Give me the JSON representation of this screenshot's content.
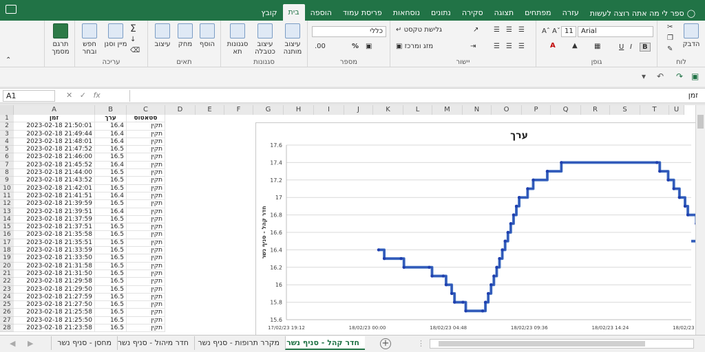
{
  "tabs": [
    "קובץ",
    "בית",
    "הוספה",
    "פריסת עמוד",
    "נוסחאות",
    "נתונים",
    "סקירה",
    "תצוגה",
    "מפתחים",
    "עזרה"
  ],
  "active_tab": "בית",
  "tell_me": "ספר לי מה אתה רוצה לעשות",
  "ribbon": {
    "groups": {
      "clipboard": "לוח",
      "font": "גופן",
      "alignment": "יישור",
      "number": "מספר",
      "styles": "סגנונות",
      "cells": "תאים",
      "editing": "עריכה"
    },
    "paste": "הדבק",
    "font_name": "Arial",
    "font_size": "11",
    "bold": "B",
    "italic": "I",
    "underline": "U",
    "wrap_text": "גלישת טקסט",
    "merge_center": "מזג ומרכז",
    "number_format": "כללי",
    "percent": "%",
    "conditional_format": "עיצוב מותנה",
    "format_as_table": "עיצוב כטבלה",
    "cell_styles": "סגנונות תא",
    "insert": "הוסף",
    "delete": "מחק",
    "format": "עיצוב",
    "sort_filter": "מיין וסנן",
    "find_select": "חפש ובחר",
    "translate": "תרגם מסמך"
  },
  "namebox": "A1",
  "formula": "זמן",
  "columns": [
    "A",
    "B",
    "C",
    "D",
    "E",
    "F",
    "G",
    "H",
    "I",
    "J",
    "K",
    "L",
    "M",
    "N",
    "O",
    "P",
    "Q",
    "R",
    "S",
    "T",
    "U"
  ],
  "headers": {
    "time": "זמן",
    "value": "ערך",
    "status": "סטאטוס"
  },
  "rows": [
    [
      "2023-02-18 21:50:01",
      "16.4",
      "תקין"
    ],
    [
      "2023-02-18 21:49:44",
      "16.4",
      "תקין"
    ],
    [
      "2023-02-18 21:48:01",
      "16.4",
      "תקין"
    ],
    [
      "2023-02-18 21:47:52",
      "16.5",
      "תקין"
    ],
    [
      "2023-02-18 21:46:00",
      "16.5",
      "תקין"
    ],
    [
      "2023-02-18 21:45:52",
      "16.4",
      "תקין"
    ],
    [
      "2023-02-18 21:44:00",
      "16.5",
      "תקין"
    ],
    [
      "2023-02-18 21:43:52",
      "16.5",
      "תקין"
    ],
    [
      "2023-02-18 21:42:01",
      "16.5",
      "תקין"
    ],
    [
      "2023-02-18 21:41:51",
      "16.4",
      "תקין"
    ],
    [
      "2023-02-18 21:39:59",
      "16.5",
      "תקין"
    ],
    [
      "2023-02-18 21:39:51",
      "16.4",
      "תקין"
    ],
    [
      "2023-02-18 21:37:59",
      "16.5",
      "תקין"
    ],
    [
      "2023-02-18 21:37:51",
      "16.5",
      "תקין"
    ],
    [
      "2023-02-18 21:35:58",
      "16.5",
      "תקין"
    ],
    [
      "2023-02-18 21:35:51",
      "16.5",
      "תקין"
    ],
    [
      "2023-02-18 21:33:59",
      "16.5",
      "תקין"
    ],
    [
      "2023-02-18 21:33:50",
      "16.5",
      "תקין"
    ],
    [
      "2023-02-18 21:31:58",
      "16.5",
      "תקין"
    ],
    [
      "2023-02-18 21:31:50",
      "16.5",
      "תקין"
    ],
    [
      "2023-02-18 21:29:58",
      "16.5",
      "תקין"
    ],
    [
      "2023-02-18 21:29:50",
      "16.5",
      "תקין"
    ],
    [
      "2023-02-18 21:27:59",
      "16.5",
      "תקין"
    ],
    [
      "2023-02-18 21:27:50",
      "16.5",
      "תקין"
    ],
    [
      "2023-02-18 21:25:58",
      "16.5",
      "תקין"
    ],
    [
      "2023-02-18 21:25:50",
      "16.5",
      "תקין"
    ],
    [
      "2023-02-18 21:23:58",
      "16.5",
      "תקין"
    ]
  ],
  "sheets": [
    "חדר קהל - סניף נשר",
    "מקרר תרופות - סניף נשר",
    "חדר מיהול - סניף נשר",
    "מחסן - סניף נשר"
  ],
  "active_sheet": "חדר קהל - סניף נשר",
  "colors": {
    "excel_green": "#217346",
    "series": "#4472c4"
  },
  "chart_data": {
    "type": "line",
    "title": "ערך",
    "ylabel": "חדר קהל - סניף נשר",
    "xlabel": "",
    "ylim": [
      15.6,
      17.6
    ],
    "yticks": [
      "17.6",
      "17.4",
      "17.2",
      "17",
      "16.8",
      "16.6",
      "16.4",
      "16.2",
      "16",
      "15.8",
      "15.6"
    ],
    "xticks": [
      "17/02/23 19:12",
      "18/02/23 00:00",
      "18/02/23 04:48",
      "18/02/23 09:36",
      "18/02/23 14:24",
      "18/02/23 19:12"
    ],
    "grid": true,
    "series": [
      {
        "points": [
          [
            "18/02/23 00:40",
            16.4
          ],
          [
            "18/02/23 01:00",
            16.3
          ],
          [
            "18/02/23 02:00",
            16.3
          ],
          [
            "18/02/23 02:10",
            16.2
          ],
          [
            "18/02/23 03:40",
            16.2
          ],
          [
            "18/02/23 03:50",
            16.1
          ],
          [
            "18/02/23 04:30",
            16.1
          ],
          [
            "18/02/23 04:40",
            16.0
          ],
          [
            "18/02/23 05:00",
            15.9
          ],
          [
            "18/02/23 05:10",
            15.8
          ],
          [
            "18/02/23 05:40",
            15.8
          ],
          [
            "18/02/23 05:50",
            15.7
          ],
          [
            "18/02/23 06:50",
            15.7
          ],
          [
            "18/02/23 07:00",
            15.8
          ],
          [
            "18/02/23 07:10",
            15.9
          ],
          [
            "18/02/23 07:20",
            16.0
          ],
          [
            "18/02/23 07:30",
            16.1
          ],
          [
            "18/02/23 07:40",
            16.2
          ],
          [
            "18/02/23 07:50",
            16.3
          ],
          [
            "18/02/23 08:00",
            16.4
          ],
          [
            "18/02/23 08:10",
            16.5
          ],
          [
            "18/02/23 08:20",
            16.6
          ],
          [
            "18/02/23 08:30",
            16.7
          ],
          [
            "18/02/23 08:40",
            16.8
          ],
          [
            "18/02/23 08:50",
            16.9
          ],
          [
            "18/02/23 09:00",
            17.0
          ],
          [
            "18/02/23 09:30",
            17.1
          ],
          [
            "18/02/23 09:50",
            17.2
          ],
          [
            "18/02/23 10:40",
            17.3
          ],
          [
            "18/02/23 11:30",
            17.4
          ],
          [
            "18/02/23 17:10",
            17.4
          ],
          [
            "18/02/23 17:20",
            17.3
          ],
          [
            "18/02/23 17:50",
            17.2
          ],
          [
            "18/02/23 18:10",
            17.1
          ],
          [
            "18/02/23 18:30",
            17.0
          ],
          [
            "18/02/23 18:50",
            16.9
          ],
          [
            "18/02/23 19:00",
            16.8
          ],
          [
            "18/02/23 19:30",
            16.7
          ],
          [
            "18/02/23 20:00",
            16.6
          ],
          [
            "18/02/23 21:00",
            16.6
          ],
          [
            "18/02/23 21:40",
            16.5
          ]
        ]
      }
    ]
  }
}
